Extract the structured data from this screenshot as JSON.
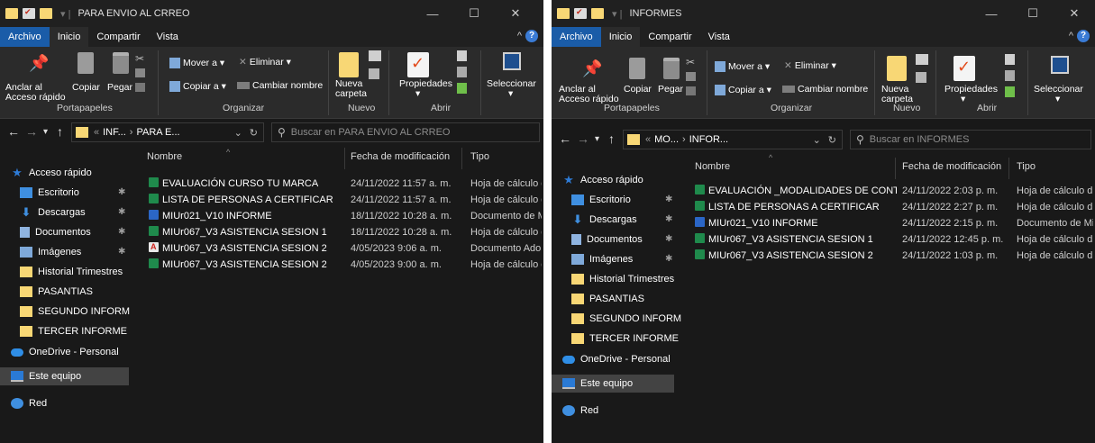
{
  "windows": {
    "left": {
      "title": "PARA ENVIO AL CRREO",
      "address": {
        "prefix": "«",
        "crumb1": "INF...",
        "crumb2": "PARA E..."
      },
      "search_placeholder": "Buscar en PARA ENVIO AL CRREO",
      "files": [
        {
          "name": "EVALUACIÓN CURSO TU MARCA",
          "date": "24/11/2022 11:57 a. m.",
          "type": "Hoja de cálculo d...",
          "icon": "excel-file-icon"
        },
        {
          "name": "LISTA DE PERSONAS A CERTIFICAR",
          "date": "24/11/2022 11:57 a. m.",
          "type": "Hoja de cálculo d...",
          "icon": "excel-file-icon"
        },
        {
          "name": "MIUr021_V10 INFORME",
          "date": "18/11/2022 10:28 a. m.",
          "type": "Documento de Mi...",
          "icon": "word-file-icon"
        },
        {
          "name": "MIUr067_V3 ASISTENCIA SESION 1",
          "date": "18/11/2022 10:28 a. m.",
          "type": "Hoja de cálculo d...",
          "icon": "excel-file-icon"
        },
        {
          "name": "MIUr067_V3 ASISTENCIA SESION 2",
          "date": "4/05/2023 9:06 a. m.",
          "type": "Documento Adob...",
          "icon": "pdf-file-icon"
        },
        {
          "name": "MIUr067_V3 ASISTENCIA SESION 2",
          "date": "4/05/2023 9:00 a. m.",
          "type": "Hoja de cálculo d...",
          "icon": "excel-file-icon"
        }
      ]
    },
    "right": {
      "title": "INFORMES",
      "address": {
        "prefix": "«",
        "crumb1": "MO...",
        "crumb2": "INFOR..."
      },
      "search_placeholder": "Buscar en INFORMES",
      "files": [
        {
          "name": "EVALUACIÓN _MODALIDADES DE CONT...",
          "date": "24/11/2022 2:03 p. m.",
          "type": "Hoja de cálculo d...",
          "icon": "excel-file-icon"
        },
        {
          "name": "LISTA DE PERSONAS A CERTIFICAR",
          "date": "24/11/2022 2:27 p. m.",
          "type": "Hoja de cálculo d...",
          "icon": "excel-file-icon"
        },
        {
          "name": "MIUr021_V10 INFORME",
          "date": "24/11/2022 2:15 p. m.",
          "type": "Documento de Mi",
          "icon": "word-file-icon"
        },
        {
          "name": "MIUr067_V3 ASISTENCIA SESION 1",
          "date": "24/11/2022 12:45 p. m.",
          "type": "Hoja de cálculo d...",
          "icon": "excel-file-icon"
        },
        {
          "name": "MIUr067_V3 ASISTENCIA SESION 2",
          "date": "24/11/2022 1:03 p. m.",
          "type": "Hoja de cálculo d...",
          "icon": "excel-file-icon"
        }
      ]
    }
  },
  "tabs": {
    "archivo": "Archivo",
    "inicio": "Inicio",
    "compartir": "Compartir",
    "vista": "Vista"
  },
  "ribbon": {
    "anclar_1": "Anclar al",
    "anclar_2": "Acceso rápido",
    "copiar": "Copiar",
    "pegar": "Pegar",
    "mover_a": "Mover a",
    "copiar_a": "Copiar a",
    "eliminar": "Eliminar",
    "cambiar_nombre": "Cambiar nombre",
    "nueva_1": "Nueva",
    "nueva_2": "carpeta",
    "propiedades": "Propiedades",
    "seleccionar": "Seleccionar",
    "group_portapapeles": "Portapapeles",
    "group_organizar": "Organizar",
    "group_nuevo": "Nuevo",
    "group_abrir": "Abrir"
  },
  "columns": {
    "nombre": "Nombre",
    "fecha": "Fecha de modificación",
    "tipo": "Tipo"
  },
  "nav": {
    "acceso_rapido": "Acceso rápido",
    "escritorio": "Escritorio",
    "descargas": "Descargas",
    "documentos": "Documentos",
    "imagenes": "Imágenes",
    "historial": "Historial Trimestres",
    "pasantias": "PASANTIAS",
    "segundo": "SEGUNDO INFORM",
    "tercer": "TERCER INFORME",
    "onedrive": "OneDrive - Personal",
    "este_equipo": "Este equipo",
    "red": "Red"
  },
  "colors": {
    "window_bg": "#191919",
    "ribbon_bg": "#2b2b2b",
    "archivo_tab": "#1a5ca8",
    "excel_icon": "#1f8a4c",
    "word_icon": "#2b66c6",
    "folder": "#f8d775"
  }
}
